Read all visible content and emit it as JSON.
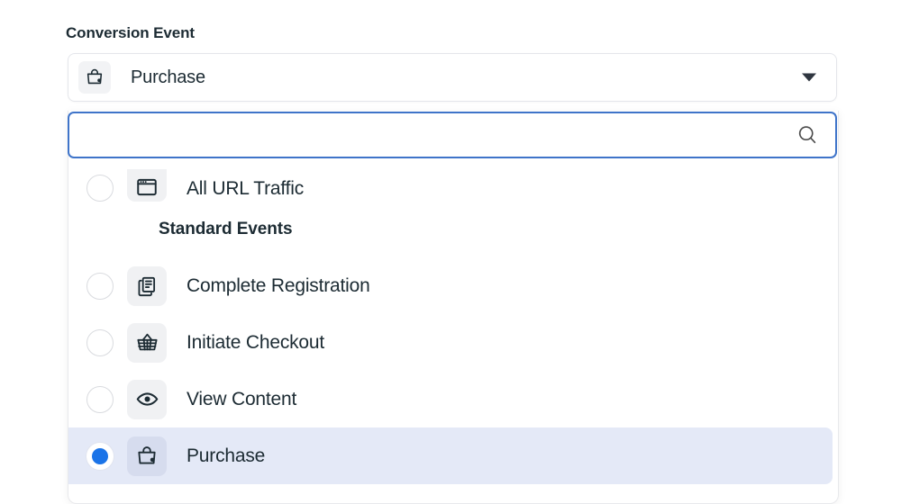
{
  "field": {
    "label": "Conversion Event",
    "selected_value": "Purchase",
    "selected_icon": "shopping-bag-icon",
    "caret_icon": "chevron-down-icon"
  },
  "search": {
    "value": "",
    "placeholder": "",
    "icon": "search-icon"
  },
  "dropdown": {
    "groups": [
      {
        "header": null,
        "options": [
          {
            "label": "All URL Traffic",
            "icon": "browser-window-icon",
            "selected": false,
            "clipped": true
          }
        ]
      },
      {
        "header": "Standard Events",
        "options": [
          {
            "label": "Complete Registration",
            "icon": "documents-stack-icon",
            "selected": false,
            "clipped": false
          },
          {
            "label": "Initiate Checkout",
            "icon": "shopping-basket-icon",
            "selected": false,
            "clipped": false
          },
          {
            "label": "View Content",
            "icon": "eye-icon",
            "selected": false,
            "clipped": false
          },
          {
            "label": "Purchase",
            "icon": "shopping-bag-icon",
            "selected": true,
            "clipped": false
          }
        ]
      }
    ]
  },
  "colors": {
    "page_background": "#ffffff",
    "text_primary": "#1c2b33",
    "accent_blue": "#1a73e8",
    "focus_border": "#3f74c9",
    "selected_row_background": "#e4e9f7",
    "icon_tile_background": "#f0f1f3",
    "border": "#e4e6eb"
  }
}
